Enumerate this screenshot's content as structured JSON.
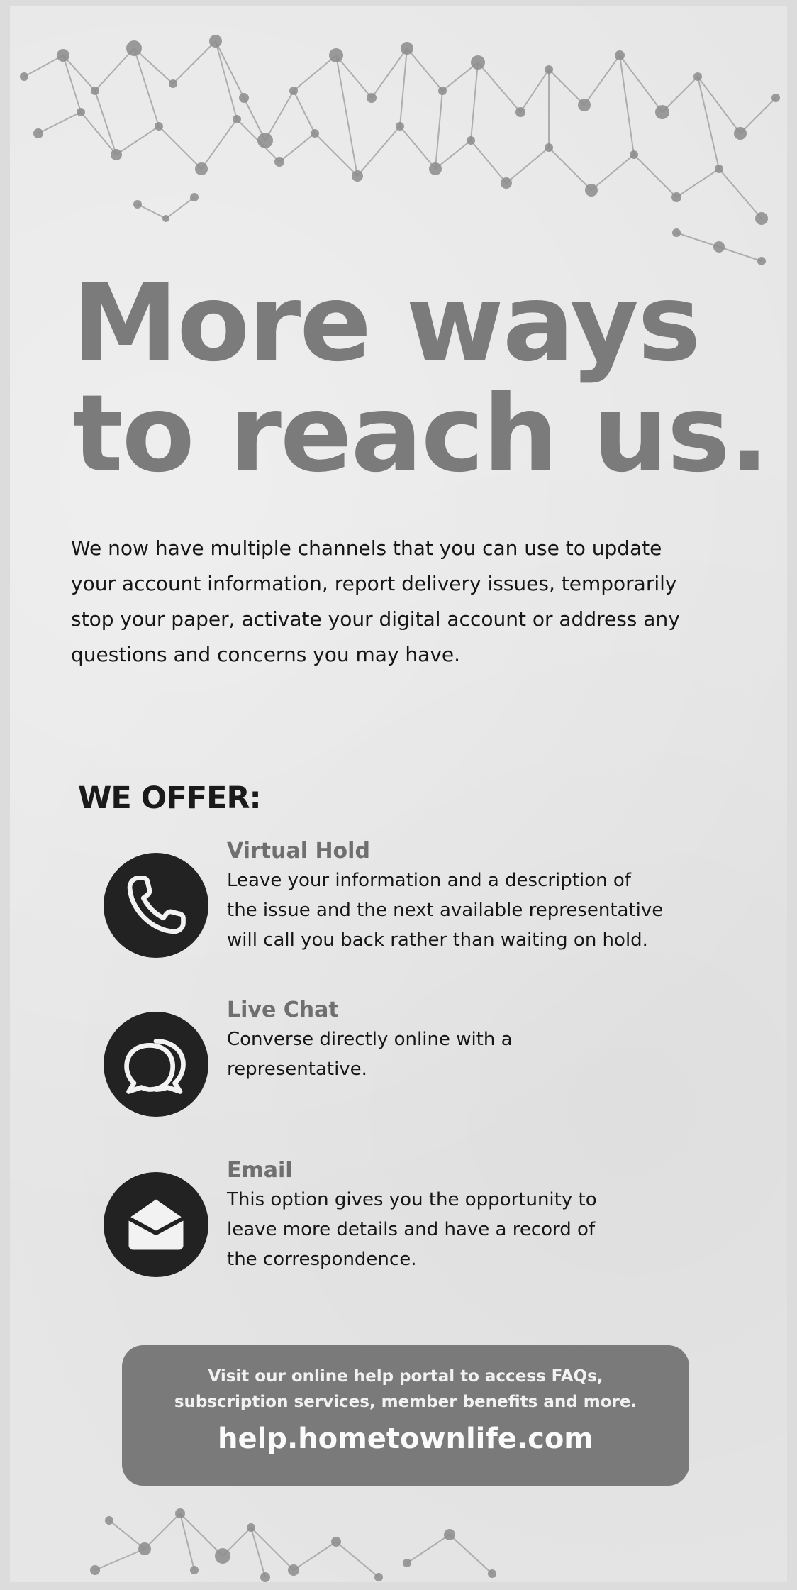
{
  "headline": {
    "line1": "More ways",
    "line2": "to reach us."
  },
  "intro": "We now have multiple channels that you can use to update your account information, report delivery issues, temporarily stop your paper, activate your digital account or address any questions and concerns you may have.",
  "offer_heading": "WE OFFER:",
  "offers": [
    {
      "icon": "phone-icon",
      "title": "Virtual Hold",
      "lines": [
        "Leave your information and a description of",
        "the issue and the next available representative",
        "will call you back rather than waiting on hold."
      ]
    },
    {
      "icon": "chat-bubbles-icon",
      "title": "Live Chat",
      "lines": [
        "Converse directly online with a",
        "representative."
      ]
    },
    {
      "icon": "envelope-icon",
      "title": "Email",
      "lines": [
        "This option gives you the opportunity to",
        "leave more details and have a record of",
        "the correspondence."
      ]
    }
  ],
  "cta": {
    "line1": "Visit our online help portal to access FAQs,",
    "line2": "subscription services, member benefits and more.",
    "url": "help.hometownlife.com"
  },
  "colors": {
    "paper": "#e6e6e6",
    "headline": "#7b7b7b",
    "body_text": "#161616",
    "offer_title": "#6f6f6f",
    "icon_circle": "#222222",
    "cta_background": "#7a7a7a",
    "cta_text": "#f1f1f1"
  }
}
